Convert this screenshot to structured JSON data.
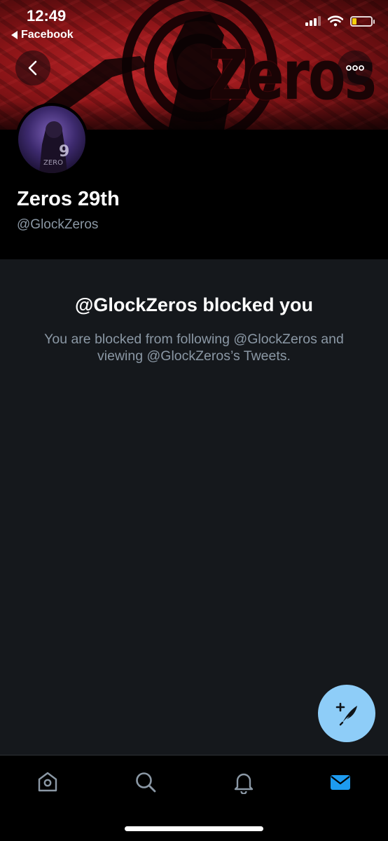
{
  "status_bar": {
    "time": "12:49",
    "back_app": "Facebook"
  },
  "banner": {
    "logo_text": "Zeros"
  },
  "profile": {
    "display_name": "Zeros 29th",
    "handle": "@GlockZeros"
  },
  "blocked": {
    "title": "@GlockZeros blocked you",
    "description": "You are blocked from following @GlockZeros and viewing @GlockZeros’s Tweets."
  },
  "tabs": [
    {
      "icon": "home-icon",
      "active": false
    },
    {
      "icon": "search-icon",
      "active": false
    },
    {
      "icon": "bell-icon",
      "active": false
    },
    {
      "icon": "mail-icon",
      "active": true
    }
  ],
  "colors": {
    "accent": "#1d9bf0",
    "fab": "#8ecdf8",
    "secondary_text": "#8b98a5",
    "banner_red": "#c0262a",
    "battery_low": "#f5d10c"
  }
}
